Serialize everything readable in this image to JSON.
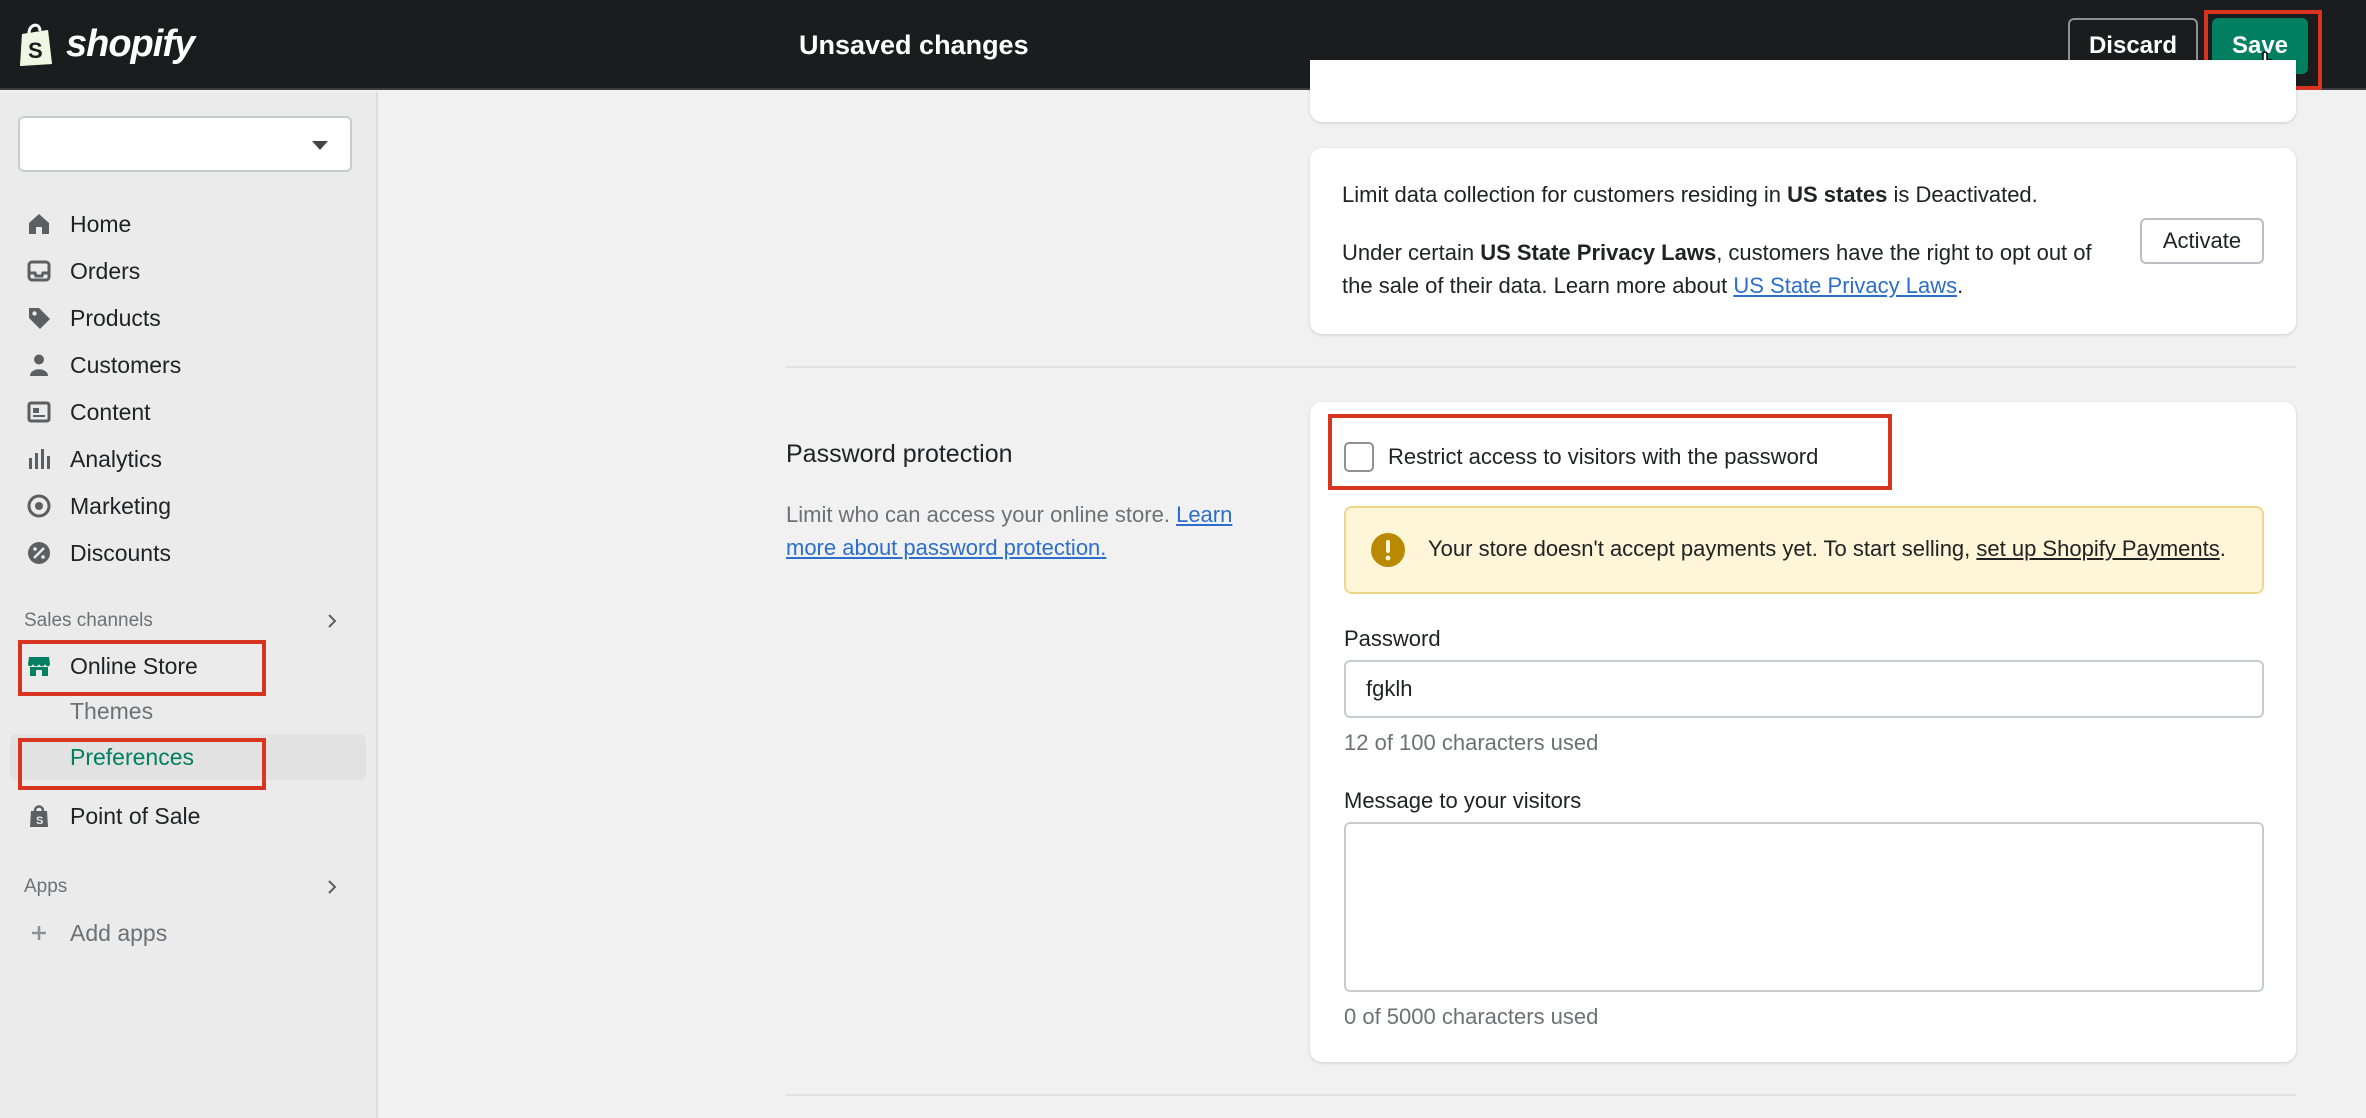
{
  "topbar": {
    "logo_text": "shopify",
    "title": "Unsaved changes",
    "discard_label": "Discard",
    "save_label": "Save"
  },
  "sidebar": {
    "store_select_value": "",
    "nav": [
      {
        "label": "Home",
        "icon": "home-icon"
      },
      {
        "label": "Orders",
        "icon": "inbox-icon"
      },
      {
        "label": "Products",
        "icon": "tag-icon"
      },
      {
        "label": "Customers",
        "icon": "person-icon"
      },
      {
        "label": "Content",
        "icon": "content-icon"
      },
      {
        "label": "Analytics",
        "icon": "bar-chart-icon"
      },
      {
        "label": "Marketing",
        "icon": "target-icon"
      },
      {
        "label": "Discounts",
        "icon": "discount-icon"
      }
    ],
    "sales_channels_label": "Sales channels",
    "online_store_label": "Online Store",
    "themes_label": "Themes",
    "preferences_label": "Preferences",
    "pos_label": "Point of Sale",
    "apps_label": "Apps",
    "add_apps_label": "Add apps"
  },
  "privacy_card": {
    "line1_pre": "Limit data collection for customers residing in ",
    "line1_bold": "US states",
    "line1_post": " is Deactivated.",
    "line2_pre": "Under certain ",
    "line2_bold": "US State Privacy Laws",
    "line2_mid": ", customers have the right to opt out of",
    "line3_pre": "the sale of their data. Learn more about ",
    "line3_link": "US State Privacy Laws",
    "line3_post": ".",
    "activate_label": "Activate"
  },
  "password_section": {
    "title": "Password protection",
    "desc_pre": "Limit who can access your online store. ",
    "desc_link": "Learn more about password protection.",
    "checkbox_label": "Restrict access to visitors with the password",
    "checkbox_checked": false,
    "banner_pre": "Your store doesn't accept payments yet. To start selling, ",
    "banner_link": "set up Shopify Payments",
    "banner_post": ".",
    "password_label": "Password",
    "password_value": "fgklh",
    "password_help": "12 of 100 characters used",
    "message_label": "Message to your visitors",
    "message_value": "",
    "message_help": "0 of 5000 characters used"
  },
  "colors": {
    "topbar_bg": "#1a1c1d",
    "save_green": "#008060",
    "active_green": "#008060",
    "link_blue": "#2c6ecb",
    "banner_bg": "#fff5d9",
    "warning_icon": "#b98900",
    "highlight_red": "#d9341f"
  }
}
